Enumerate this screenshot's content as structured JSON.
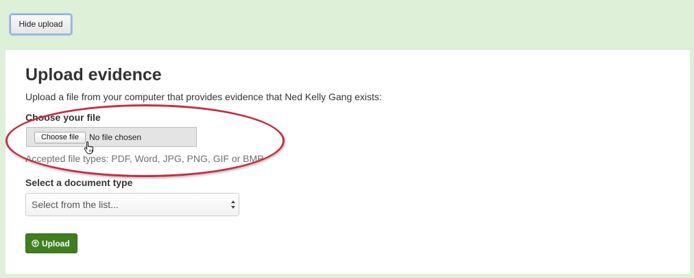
{
  "toolbar": {
    "hide_upload_label": "Hide upload"
  },
  "panel": {
    "title": "Upload evidence",
    "intro": "Upload a file from your computer that provides evidence that Ned Kelly Gang exists:",
    "file_field": {
      "label": "Choose your file",
      "button_label": "Choose file",
      "status_text": "No file chosen",
      "hint": "Accepted file types: PDF, Word, JPG, PNG, GIF or BMP"
    },
    "document_type": {
      "label": "Select a document type",
      "selected_value": "Select from the list..."
    },
    "upload_button": {
      "label": "Upload",
      "icon": "upload-circle-icon"
    }
  },
  "colors": {
    "outer_background": "#dff0d8",
    "highlight_ring": "#c62e3f",
    "upload_button": "#3f7f1f"
  }
}
